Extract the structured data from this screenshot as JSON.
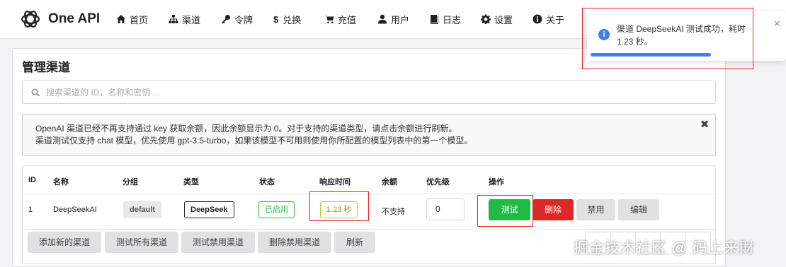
{
  "app": {
    "name": "One API"
  },
  "nav": {
    "home": "首页",
    "channels": "渠道",
    "tokens": "令牌",
    "redeem": "兑换",
    "topup": "充值",
    "users": "用户",
    "logs": "日志",
    "settings": "设置",
    "about": "关于"
  },
  "page": {
    "title": "管理渠道"
  },
  "search": {
    "placeholder": "搜索渠道的 ID，名称和密钥 ..."
  },
  "notice": {
    "line1": "OpenAI 渠道已经不再支持通过 key 获取余额，因此余额显示为 0。对于支持的渠道类型，请点击余额进行刷新。",
    "line2": "渠道测试仅支持 chat 模型，优先使用 gpt-3.5-turbo，如果该模型不可用则使用你所配置的模型列表中的第一个模型。",
    "close": "✖"
  },
  "table": {
    "headers": {
      "id": "ID",
      "name": "名称",
      "group": "分组",
      "type": "类型",
      "status": "状态",
      "response": "响应时间",
      "balance": "余额",
      "priority": "优先级",
      "actions": "操作"
    },
    "rows": [
      {
        "id": "1",
        "name": "DeepSeekAI",
        "group": "default",
        "type": "DeepSeek",
        "status": "已启用",
        "response": "1.23 秒",
        "balance": "不支持",
        "priority": "0",
        "actions": {
          "test": "测试",
          "delete": "删除",
          "disable": "禁用",
          "edit": "编辑"
        }
      }
    ]
  },
  "footer_buttons": {
    "add": "添加新的渠道",
    "test_all": "测试所有渠道",
    "test_disabled": "测试禁用渠道",
    "delete_disabled": "删除禁用渠道",
    "refresh": "刷新"
  },
  "toast": {
    "message": "渠道 DeepSeekAI 测试成功，耗时 1.23 秒。",
    "close": "✕"
  },
  "watermark": "掘金技术社区 @ 码上来財",
  "colors": {
    "green": "#21ba45",
    "red": "#db2828",
    "blue": "#3a82f7",
    "olive": "#b5cc18",
    "highlight": "#ee2222"
  }
}
